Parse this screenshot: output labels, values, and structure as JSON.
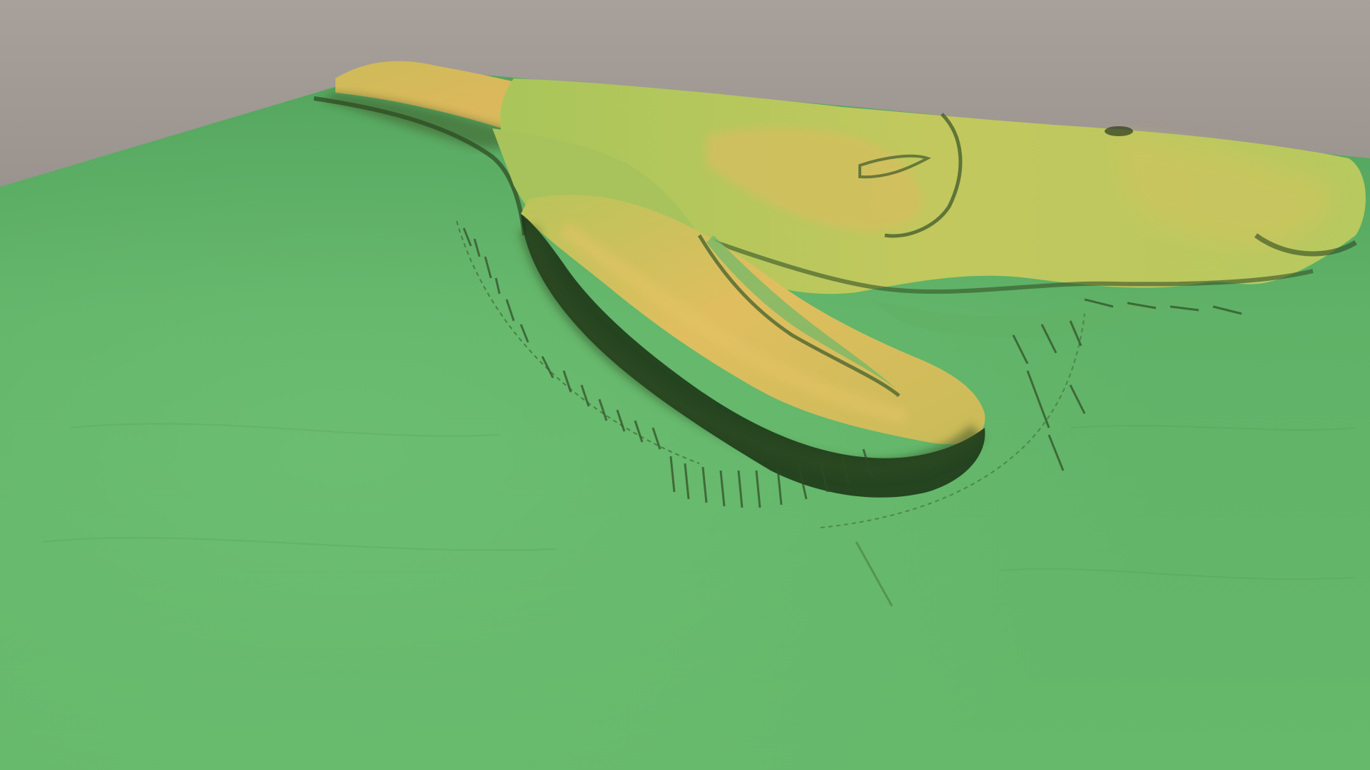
{
  "viewer": {
    "background_top": "#a39c98",
    "background_bottom": "#6f6b6a"
  },
  "terrain": {
    "colors": {
      "lowland": "#5cae63",
      "lowland_light": "#6fbe72",
      "midland": "#9cc55a",
      "upland": "#cfc35a",
      "peak": "#d9b35b",
      "shadow": "#243f1e",
      "ridge_edge": "#3a5a2c"
    }
  }
}
